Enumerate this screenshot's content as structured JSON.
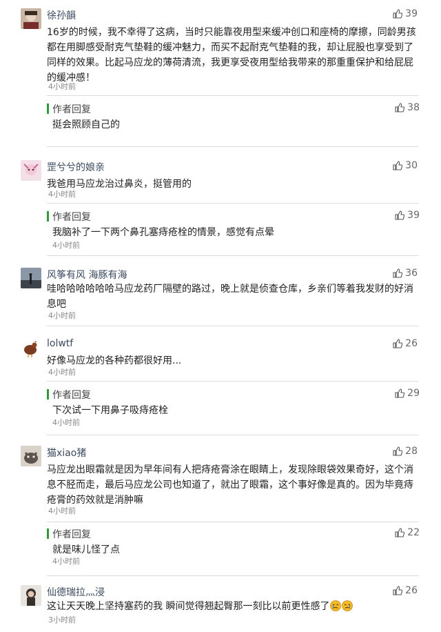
{
  "comments": [
    {
      "author": "徐孙韻",
      "likes": "39",
      "text": "16岁的时候，我不幸得了这病，当时只能靠夜用型来缓冲创口和座椅的摩擦，同龄男孩都在用脚感受耐克气垫鞋的缓冲魅力，而买不起耐克气垫鞋的我，却让屁股也享受到了同样的效果。比起马应龙的薄荷清流，我更享受夜用型给我带来的那重重保护和给屁屁的缓冲感！",
      "time": "4小时前",
      "reply": {
        "tag": "作者回复",
        "text": "挺会照顾自己的",
        "likes": "38"
      }
    },
    {
      "author": "罡兮兮的娘亲",
      "likes": "30",
      "text": "我爸用马应龙治过鼻炎，挺管用的",
      "time": "4小时前",
      "reply": {
        "tag": "作者回复",
        "text": "我脑补了一下两个鼻孔塞痔疮栓的情景，感觉有点晕",
        "likes": "39",
        "time": "4小时前"
      }
    },
    {
      "author": "风筝有风 海豚有海",
      "likes": "36",
      "text": "哇哈哈哈哈哈哈马应龙药厂隔壁的路过，晚上就是侦查仓库，乡亲们等着我发财的好消息吧",
      "time": "4小时前"
    },
    {
      "author": "lolwtf",
      "likes": "26",
      "text": "好像马应龙的各种药都很好用...",
      "time": "4小时前",
      "reply": {
        "tag": "作者回复",
        "text": "下次试一下用鼻子吸痔疮栓",
        "likes": "29",
        "time": "4小时前"
      }
    },
    {
      "author": "猫xiao猪",
      "likes": "28",
      "text": "马应龙出眼霜就是因为早年间有人把痔疮膏涂在眼睛上，发现除眼袋效果奇好，这个消息不胫而走，最后马应龙公司也知道了，就出了眼霜，这个事好像是真的。因为毕竟痔疮膏的药效就是消肿嘛",
      "time": "4小时前",
      "reply": {
        "tag": "作者回复",
        "text": "就是味儿怪了点",
        "likes": "22",
        "time": "4小时前"
      }
    },
    {
      "author": "仙德瑞拉灬浸",
      "likes": "26",
      "text": "这让天天晚上坚持塞药的我 瞬间觉得翘起臀那一刻比以前更性感了",
      "time": "3小时前"
    }
  ],
  "icons": {
    "like": "thumbs-up-icon",
    "emoji": "crying-face-icon"
  },
  "colors": {
    "reply_bar": "#2e9b3a",
    "author": "#3b4a60",
    "muted": "#888888"
  }
}
